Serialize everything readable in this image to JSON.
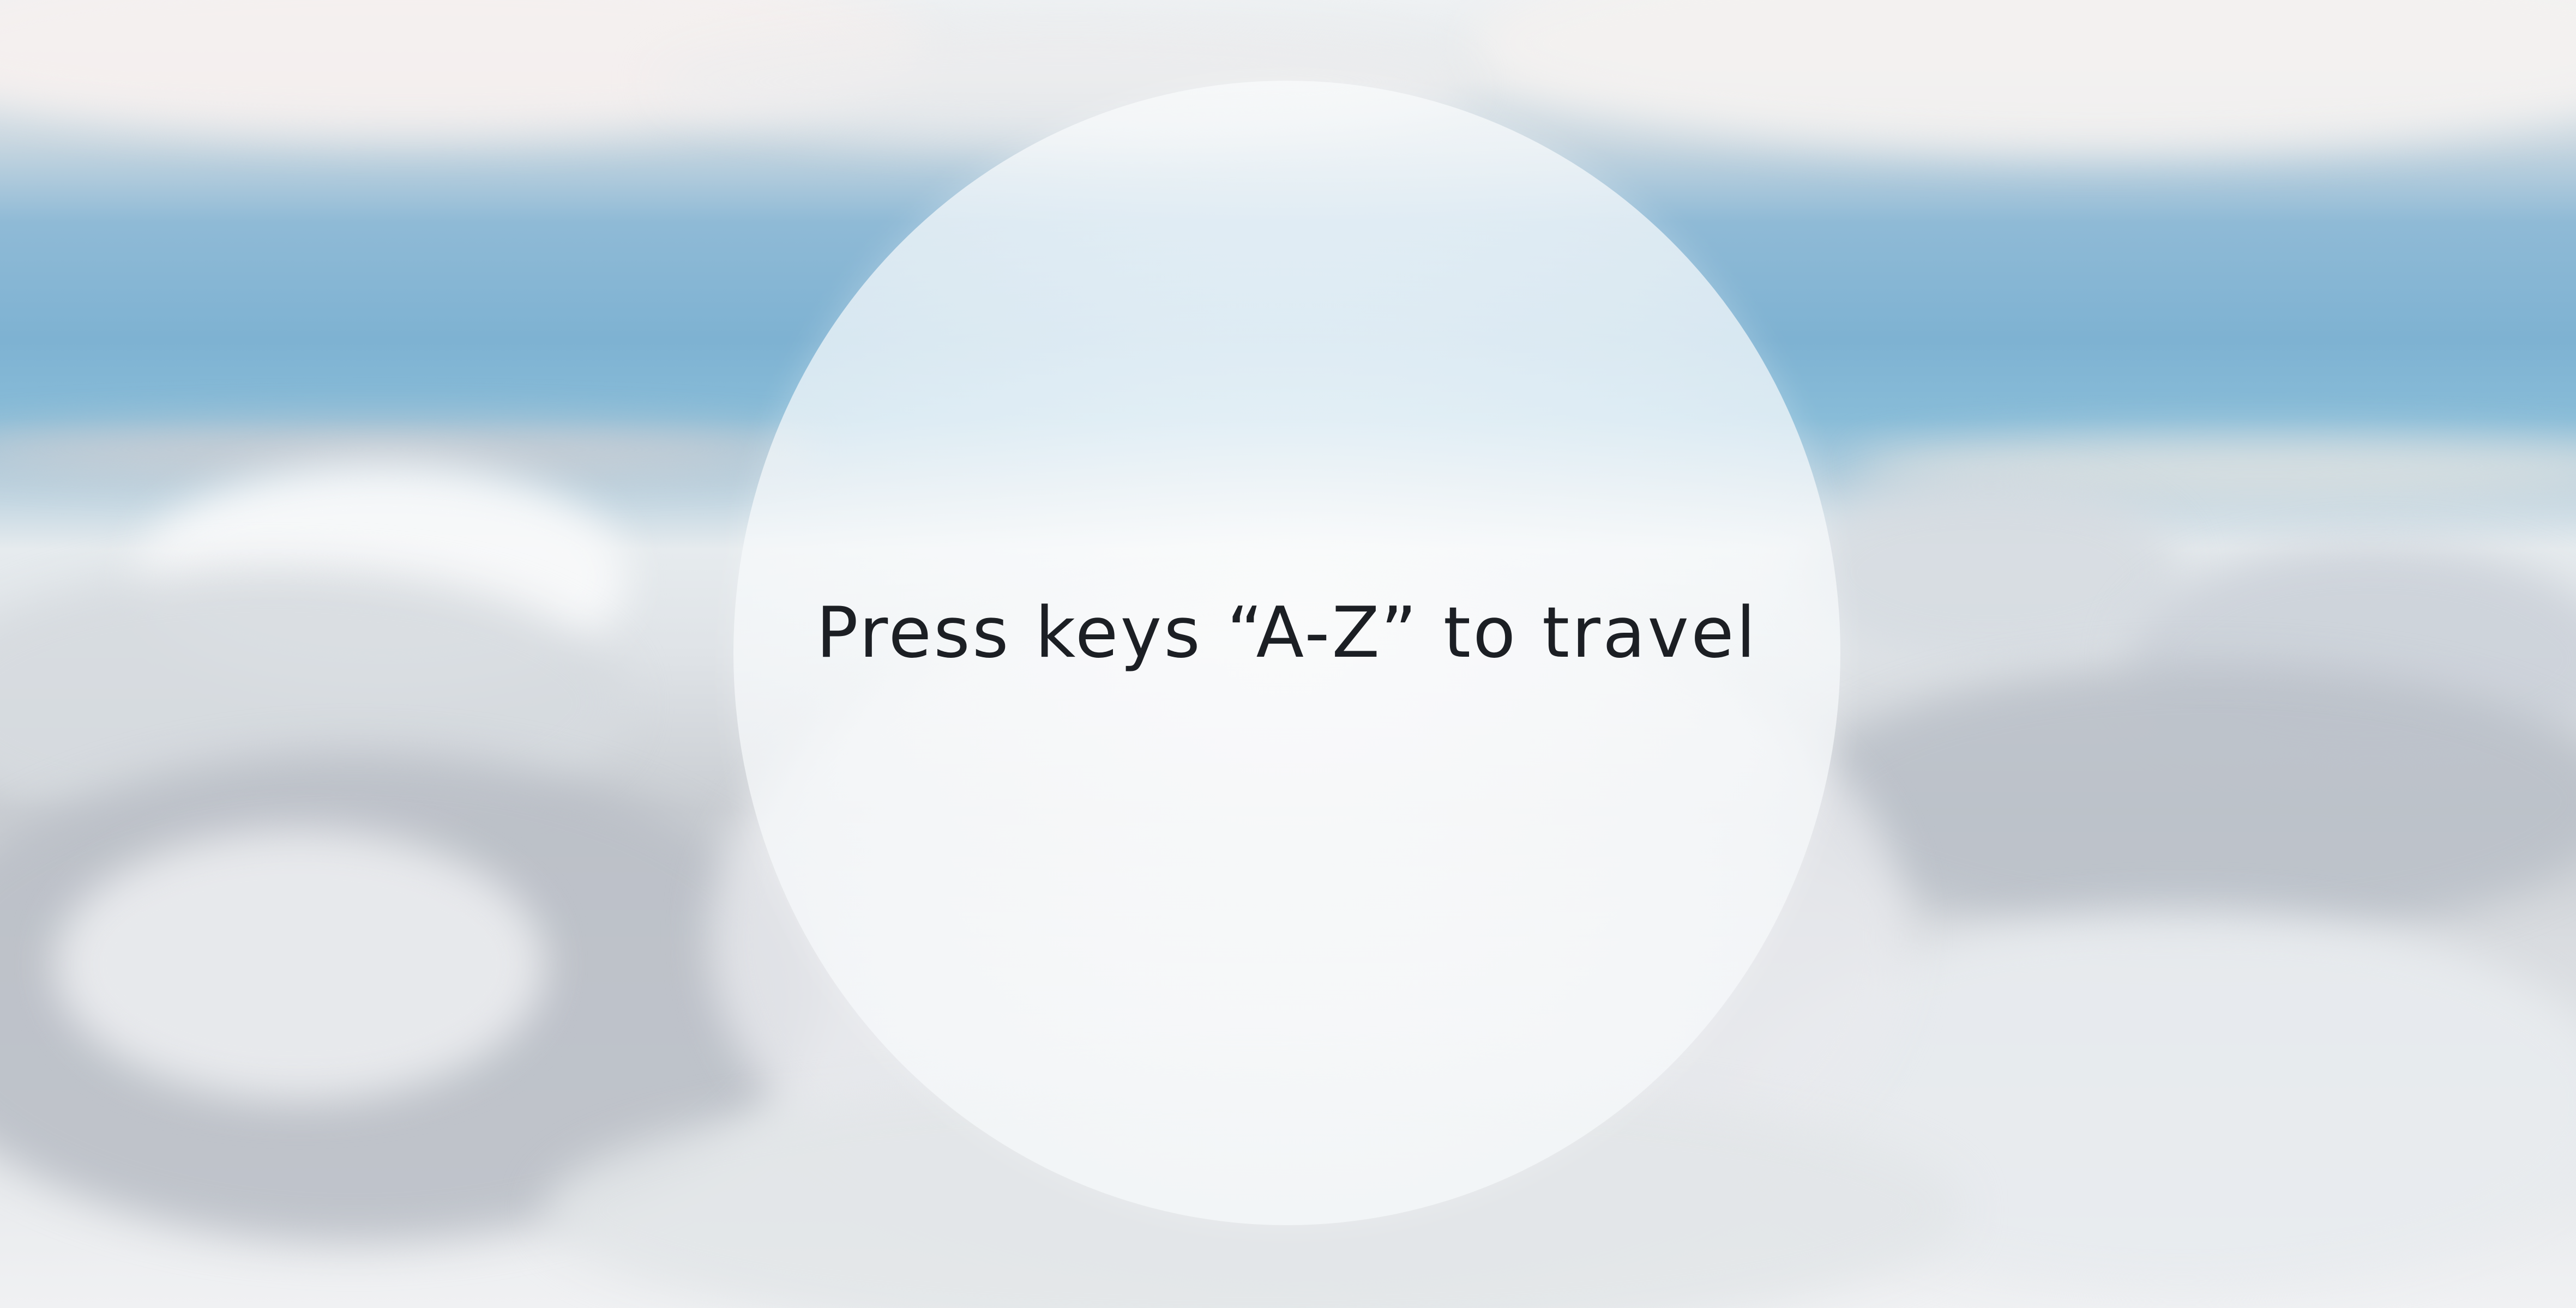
{
  "prompt": {
    "text": "Press keys “A-Z” to travel"
  },
  "colors": {
    "sky_blue": "#7eb2d2",
    "cloud_white": "#f2f4f6",
    "cloud_shadow": "#b9bec5",
    "text": "#1c1f24"
  }
}
